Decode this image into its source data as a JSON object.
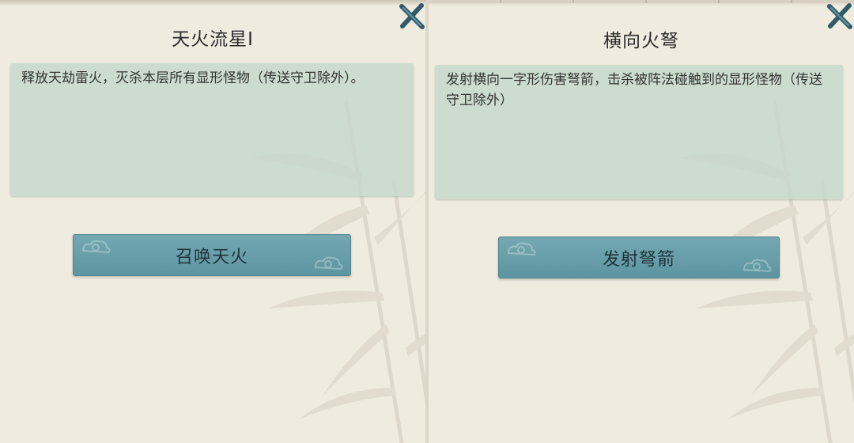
{
  "panels": [
    {
      "title": "天火流星I",
      "description": "释放天劫雷火，灭杀本层所有显形怪物（传送守卫除外）。",
      "action_label": "召唤天火",
      "close_icon": "close-x-icon"
    },
    {
      "title": "横向火弩",
      "description": "发射横向一字形伤害弩箭，击杀被阵法碰触到的显形怪物（传送守卫除外）",
      "action_label": "发射弩箭",
      "close_icon": "close-x-icon"
    }
  ],
  "colors": {
    "panel_bg": "#efebdf",
    "desc_bg": "#c5d8cb",
    "button_bg": "#6aa0ab",
    "close_icon": "#2f5b6b"
  }
}
